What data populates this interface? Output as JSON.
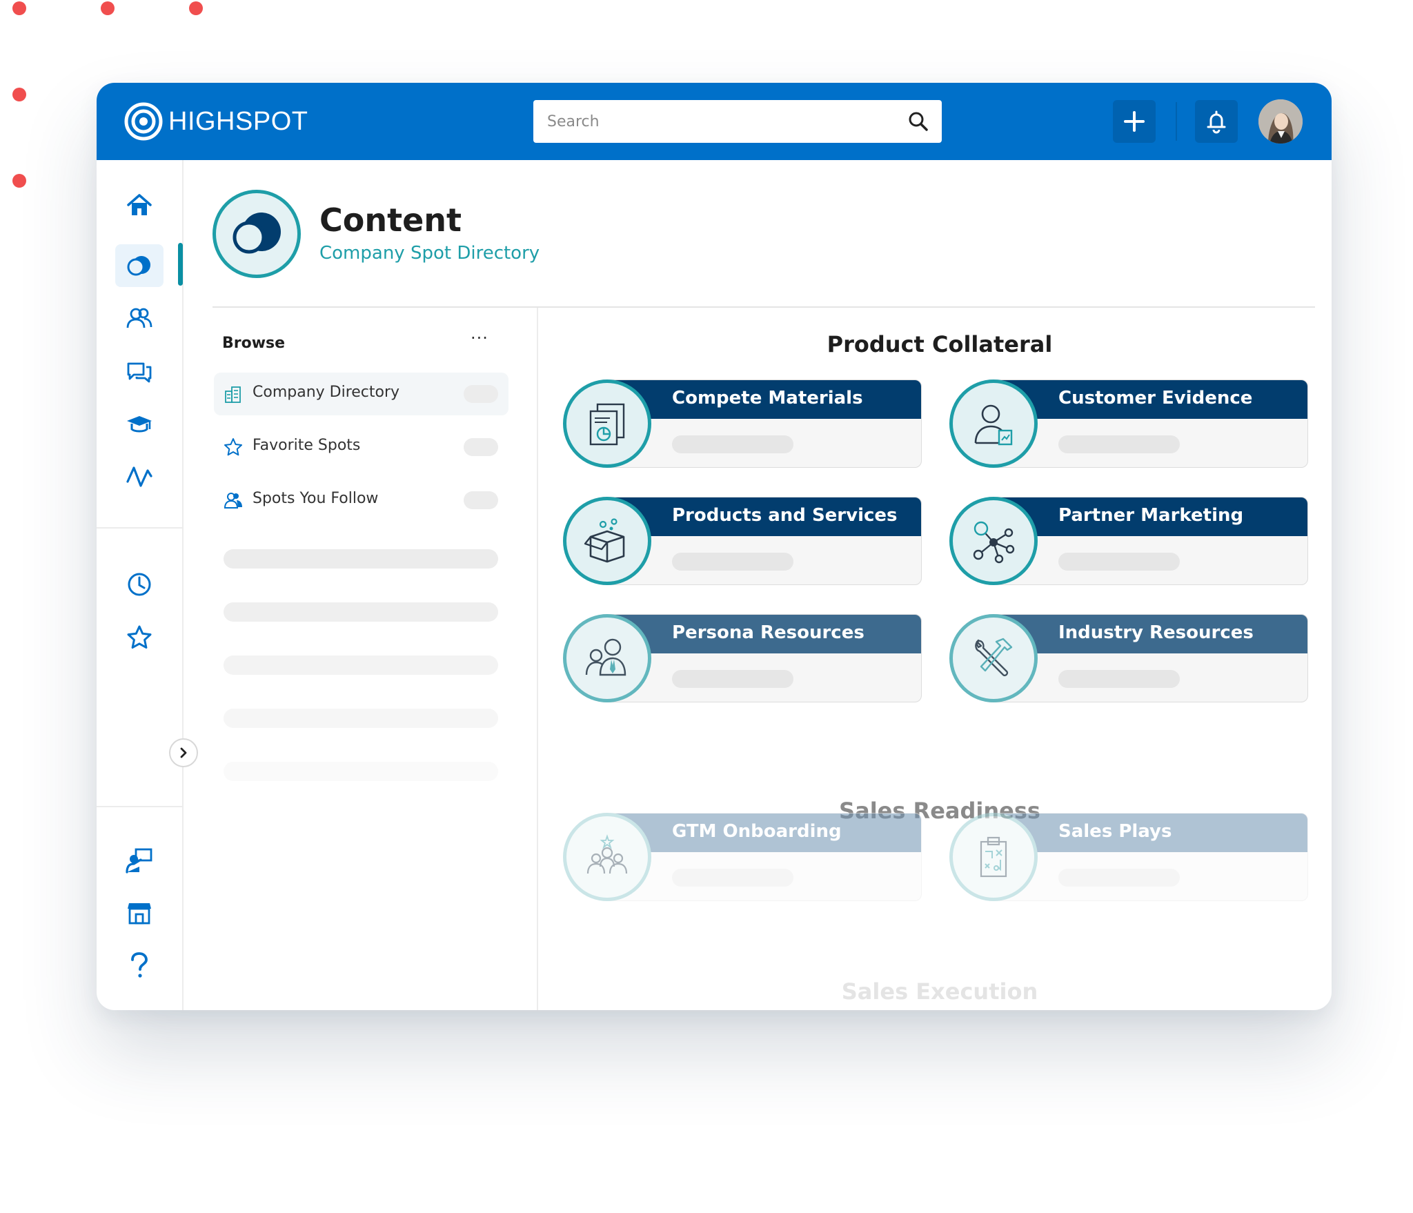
{
  "brand": {
    "name": "HIGHSPOT",
    "accent": "#0070c9",
    "teal": "#1e9ea8",
    "navy": "#023d6e"
  },
  "search": {
    "placeholder": "Search"
  },
  "toolbar": {
    "add_icon": "plus-icon",
    "notifications_icon": "bell-icon"
  },
  "rail": {
    "top_icons": [
      "home-icon",
      "content-icon",
      "people-icon",
      "chat-icon",
      "training-icon",
      "analytics-icon"
    ],
    "mid_icons": [
      "clock-icon",
      "star-icon"
    ],
    "bottom_icons": [
      "presenter-icon",
      "store-icon",
      "help-icon"
    ],
    "active": "content-icon"
  },
  "header": {
    "title": "Content",
    "subtitle": "Company Spot Directory"
  },
  "browse": {
    "title": "Browse",
    "more_label": "···",
    "items": [
      {
        "label": "Company Directory",
        "icon": "buildings-icon",
        "selected": true
      },
      {
        "label": "Favorite Spots",
        "icon": "star-icon",
        "selected": false
      },
      {
        "label": "Spots You Follow",
        "icon": "people-icon",
        "selected": false
      }
    ]
  },
  "sections": [
    {
      "title": "Product Collateral",
      "cards": [
        {
          "label": "Compete Materials",
          "icon": "documents-icon"
        },
        {
          "label": "Customer Evidence",
          "icon": "person-chart-icon"
        },
        {
          "label": "Products and Services",
          "icon": "box-icon"
        },
        {
          "label": "Partner Marketing",
          "icon": "network-icon"
        },
        {
          "label": "Persona Resources",
          "icon": "persona-icon"
        },
        {
          "label": "Industry Resources",
          "icon": "tools-icon"
        }
      ]
    },
    {
      "title": "Sales Readiness",
      "cards": [
        {
          "label": "GTM Onboarding",
          "icon": "team-icon"
        },
        {
          "label": "Sales Plays",
          "icon": "clipboard-play-icon"
        }
      ]
    },
    {
      "title": "Sales Execution",
      "cards": []
    }
  ]
}
